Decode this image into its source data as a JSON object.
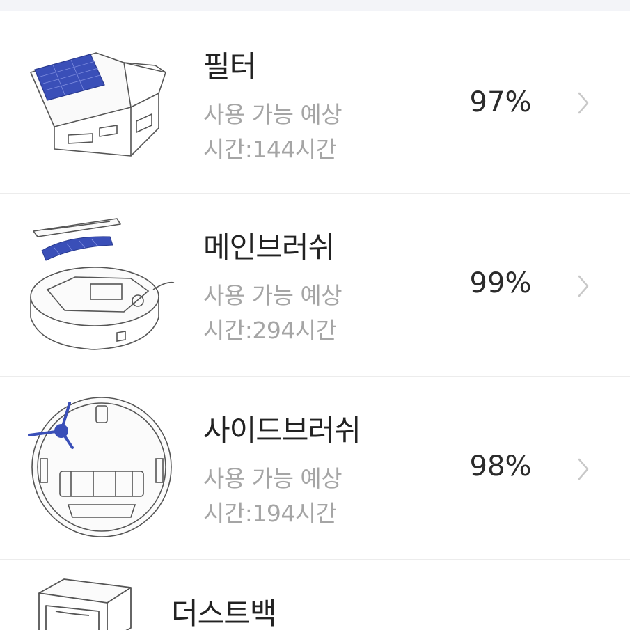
{
  "items": [
    {
      "name": "필터",
      "desc_line1": "사용 가능 예상",
      "desc_line2": "시간:144시간",
      "percent": "97%",
      "image_icon": "filter-icon",
      "chevron_icon": "chevron-right-icon"
    },
    {
      "name": "메인브러쉬",
      "desc_line1": "사용 가능 예상",
      "desc_line2": "시간:294시간",
      "percent": "99%",
      "image_icon": "main-brush-icon",
      "chevron_icon": "chevron-right-icon"
    },
    {
      "name": "사이드브러쉬",
      "desc_line1": "사용 가능 예상",
      "desc_line2": "시간:194시간",
      "percent": "98%",
      "image_icon": "side-brush-icon",
      "chevron_icon": "chevron-right-icon"
    },
    {
      "name": "더스트백",
      "image_icon": "dust-bag-icon"
    }
  ],
  "colors": {
    "accent": "#3a4fb8",
    "title": "#222222",
    "subtitle": "#a5a5a5",
    "chevron": "#c8c8c8",
    "divider": "#ececec"
  }
}
